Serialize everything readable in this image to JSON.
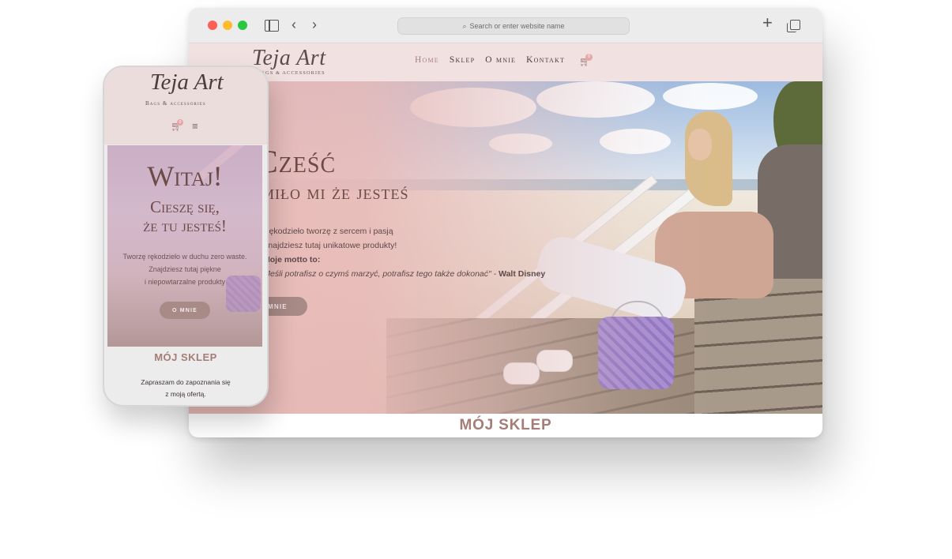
{
  "browser": {
    "address_placeholder": "Search or enter website name",
    "icons": [
      "sidebar-icon",
      "back-icon",
      "forward-icon",
      "search-icon",
      "new-tab-icon",
      "tabs-overview-icon"
    ]
  },
  "site": {
    "logo_text": "Teja Art",
    "logo_sub": "Bags & accessories",
    "nav": [
      {
        "label": "Home",
        "active": true
      },
      {
        "label": "Sklep",
        "active": false
      },
      {
        "label": "O mnie",
        "active": false
      },
      {
        "label": "Kontakt",
        "active": false
      }
    ],
    "cart_count": "0"
  },
  "hero": {
    "heading": "Cześć",
    "subheading": "miło mi że jesteś",
    "line1": "Rękodzieło tworzę z sercem i pasją",
    "line2": "Znajdziesz tutaj unikatowe produkty!",
    "line3": "Moje motto to:",
    "quote": "\"Jeśli potrafisz o czymś marzyć, potrafisz tego także dokonać\" - ",
    "quote_author": "Walt Disney",
    "button": "O MNIE"
  },
  "shop_section": {
    "title": "MÓJ SKLEP"
  },
  "mobile": {
    "logo_text": "Teja Art",
    "logo_sub": "Bags & accessories",
    "cart_count": "0",
    "heading": "Witaj!",
    "sub1": "Cieszę się,",
    "sub2": "że tu jesteś!",
    "p1": "Tworzę rękodzieło w duchu zero waste.",
    "p2": "Znajdziesz tutaj piękne",
    "p3": "i niepowtarzalne produkty",
    "button": "O MNIE",
    "shop_title": "MÓJ SKLEP",
    "shop_text1": "Zapraszam do zapoznania się",
    "shop_text2": "z moją ofertą."
  },
  "colors": {
    "accent": "#a88080",
    "header_bg": "#f1e1e1",
    "heading": "#6b4a47",
    "button_bg": "#a88a87",
    "shop_title": "#a47d76"
  }
}
